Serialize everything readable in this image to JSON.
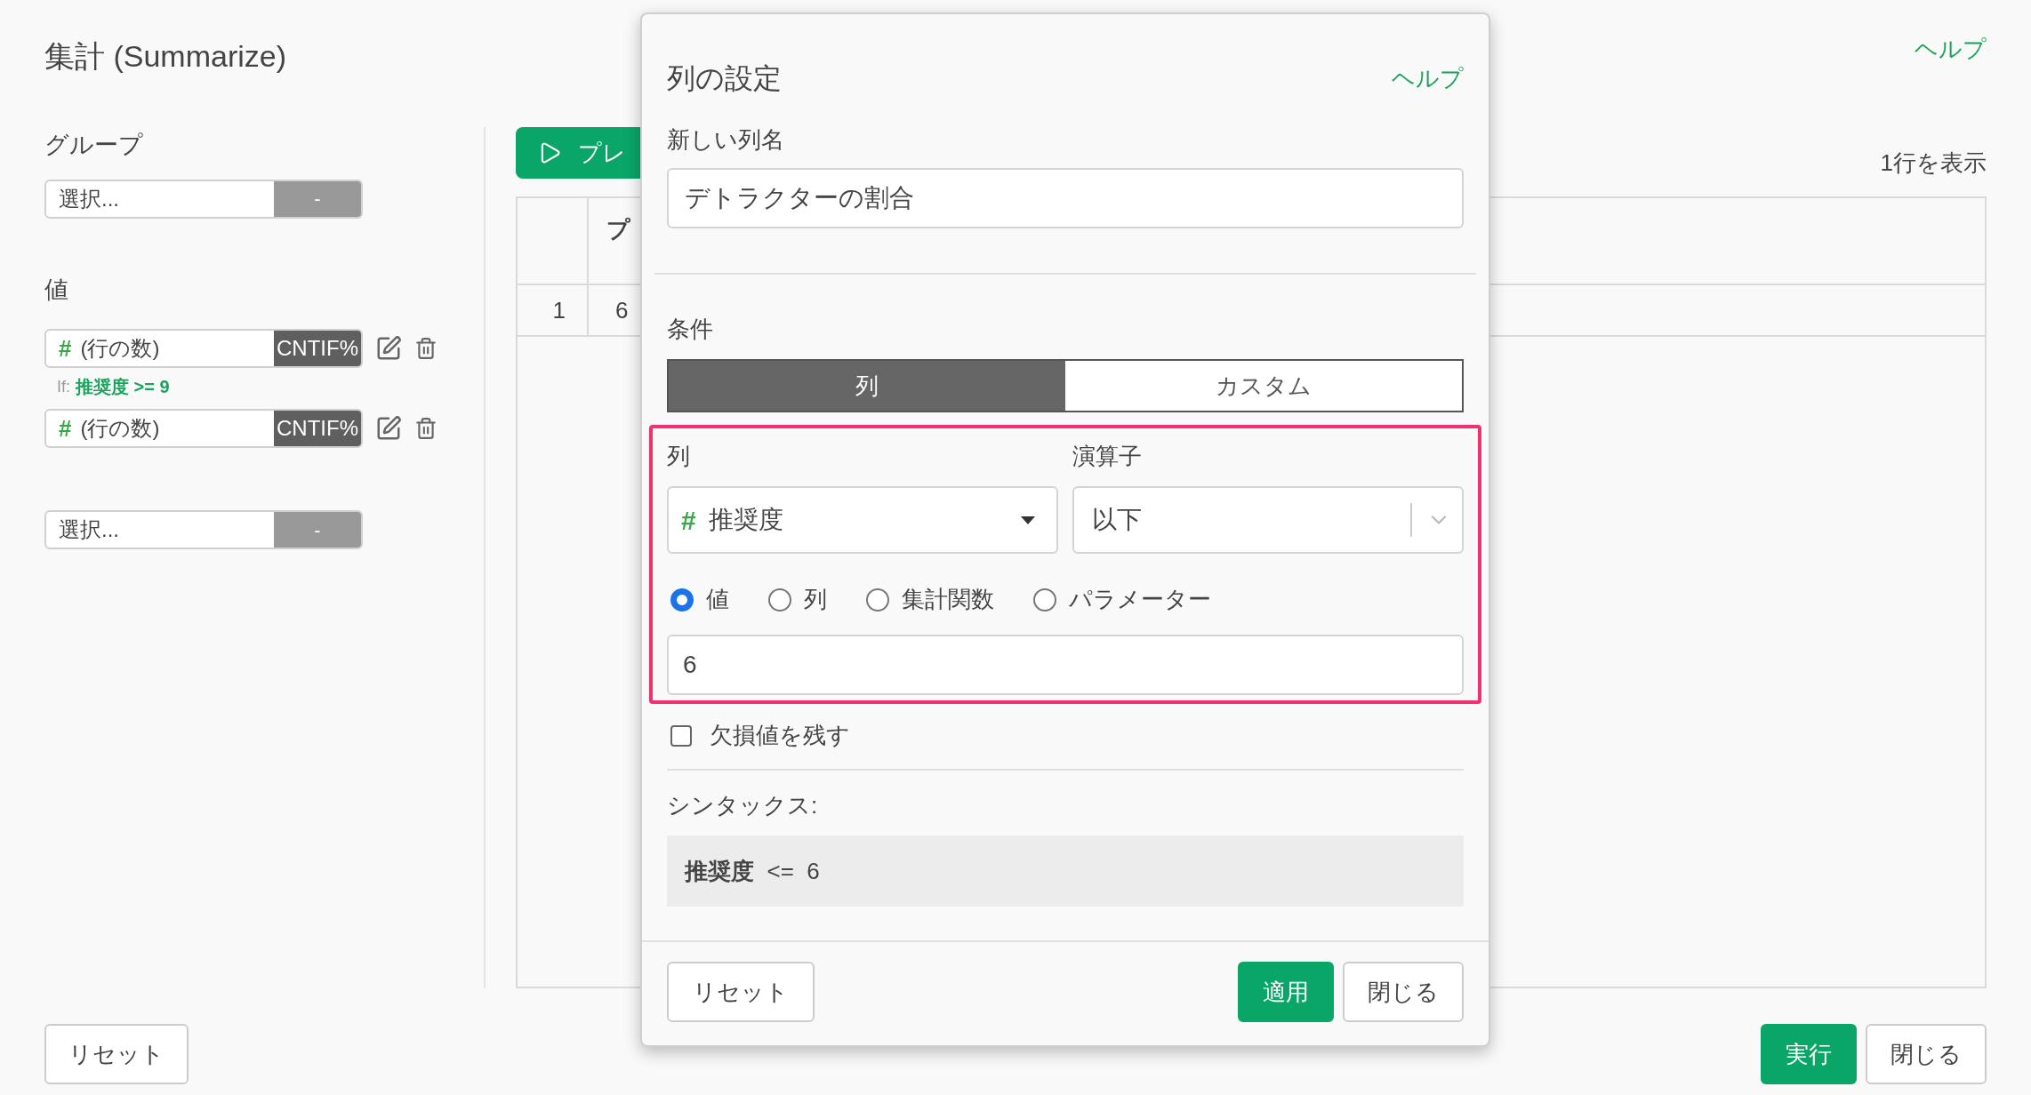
{
  "page": {
    "title": "集計 (Summarize)",
    "help": "ヘルプ"
  },
  "group": {
    "label": "グループ",
    "select": {
      "placeholder": "選択...",
      "button": "-"
    }
  },
  "values": {
    "label": "値",
    "items": [
      {
        "type_mark": "#",
        "name": "(行の数)",
        "func": "CNTIF%",
        "condition": {
          "prefix": "If:",
          "text": "推奨度 >= 9"
        }
      },
      {
        "type_mark": "#",
        "name": "(行の数)",
        "func": "CNTIF%"
      }
    ],
    "new_select": {
      "placeholder": "選択...",
      "button": "-"
    }
  },
  "preview": {
    "button": "プレ",
    "row_count": "1行を表示"
  },
  "table": {
    "columns": [
      "",
      "プ"
    ],
    "rows": [
      [
        "1",
        "6"
      ]
    ]
  },
  "dialog": {
    "title": "列の設定",
    "help": "ヘルプ",
    "name_label": "新しい列名",
    "name_value": "デトラクターの割合",
    "condition_label": "条件",
    "condition_tabs": [
      {
        "label": "列",
        "selected": true
      },
      {
        "label": "カスタム",
        "selected": false
      }
    ],
    "column_label": "列",
    "column_select": {
      "type_mark": "#",
      "value": "推奨度"
    },
    "operator_label": "演算子",
    "operator_select": {
      "value": "以下"
    },
    "value_types": [
      {
        "label": "値",
        "selected": true
      },
      {
        "label": "列",
        "selected": false
      },
      {
        "label": "集計関数",
        "selected": false
      },
      {
        "label": "パラメーター",
        "selected": false
      }
    ],
    "value": "6",
    "keep_na": {
      "label": "欠損値を残す",
      "checked": false
    },
    "syntax_label": "シンタックス:",
    "syntax": "**推奨度**  <=  6",
    "buttons": {
      "reset": "リセット",
      "apply": "適用",
      "close": "閉じる"
    }
  },
  "footer": {
    "reset": "リセット",
    "run": "実行",
    "close": "閉じる"
  }
}
